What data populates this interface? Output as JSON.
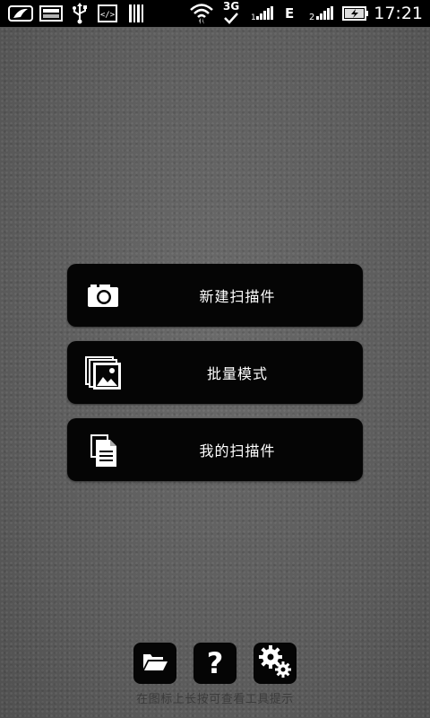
{
  "status_bar": {
    "time": "17:21",
    "network_3g": "3G",
    "network_e": "E",
    "sim2_label": "2",
    "icons": [
      "sd-card-icon",
      "image-icon",
      "usb-icon",
      "code-icon",
      "barcode-icon",
      "wifi-icon",
      "signal-icon",
      "signal-icon-2",
      "battery-charging-icon"
    ]
  },
  "menu": {
    "new_scan_label": "新建扫描件",
    "batch_mode_label": "批量模式",
    "my_scans_label": "我的扫描件"
  },
  "toolbar": {
    "help_glyph": "?",
    "icons": [
      "folder-open-icon",
      "help-icon",
      "settings-gears-icon"
    ]
  },
  "hint": "在图标上长按可查看工具提示",
  "colors": {
    "background": "#5f5f5f",
    "button_bg": "#050505",
    "button_text": "#ffffff",
    "hint_text": "#3c3c3c"
  }
}
